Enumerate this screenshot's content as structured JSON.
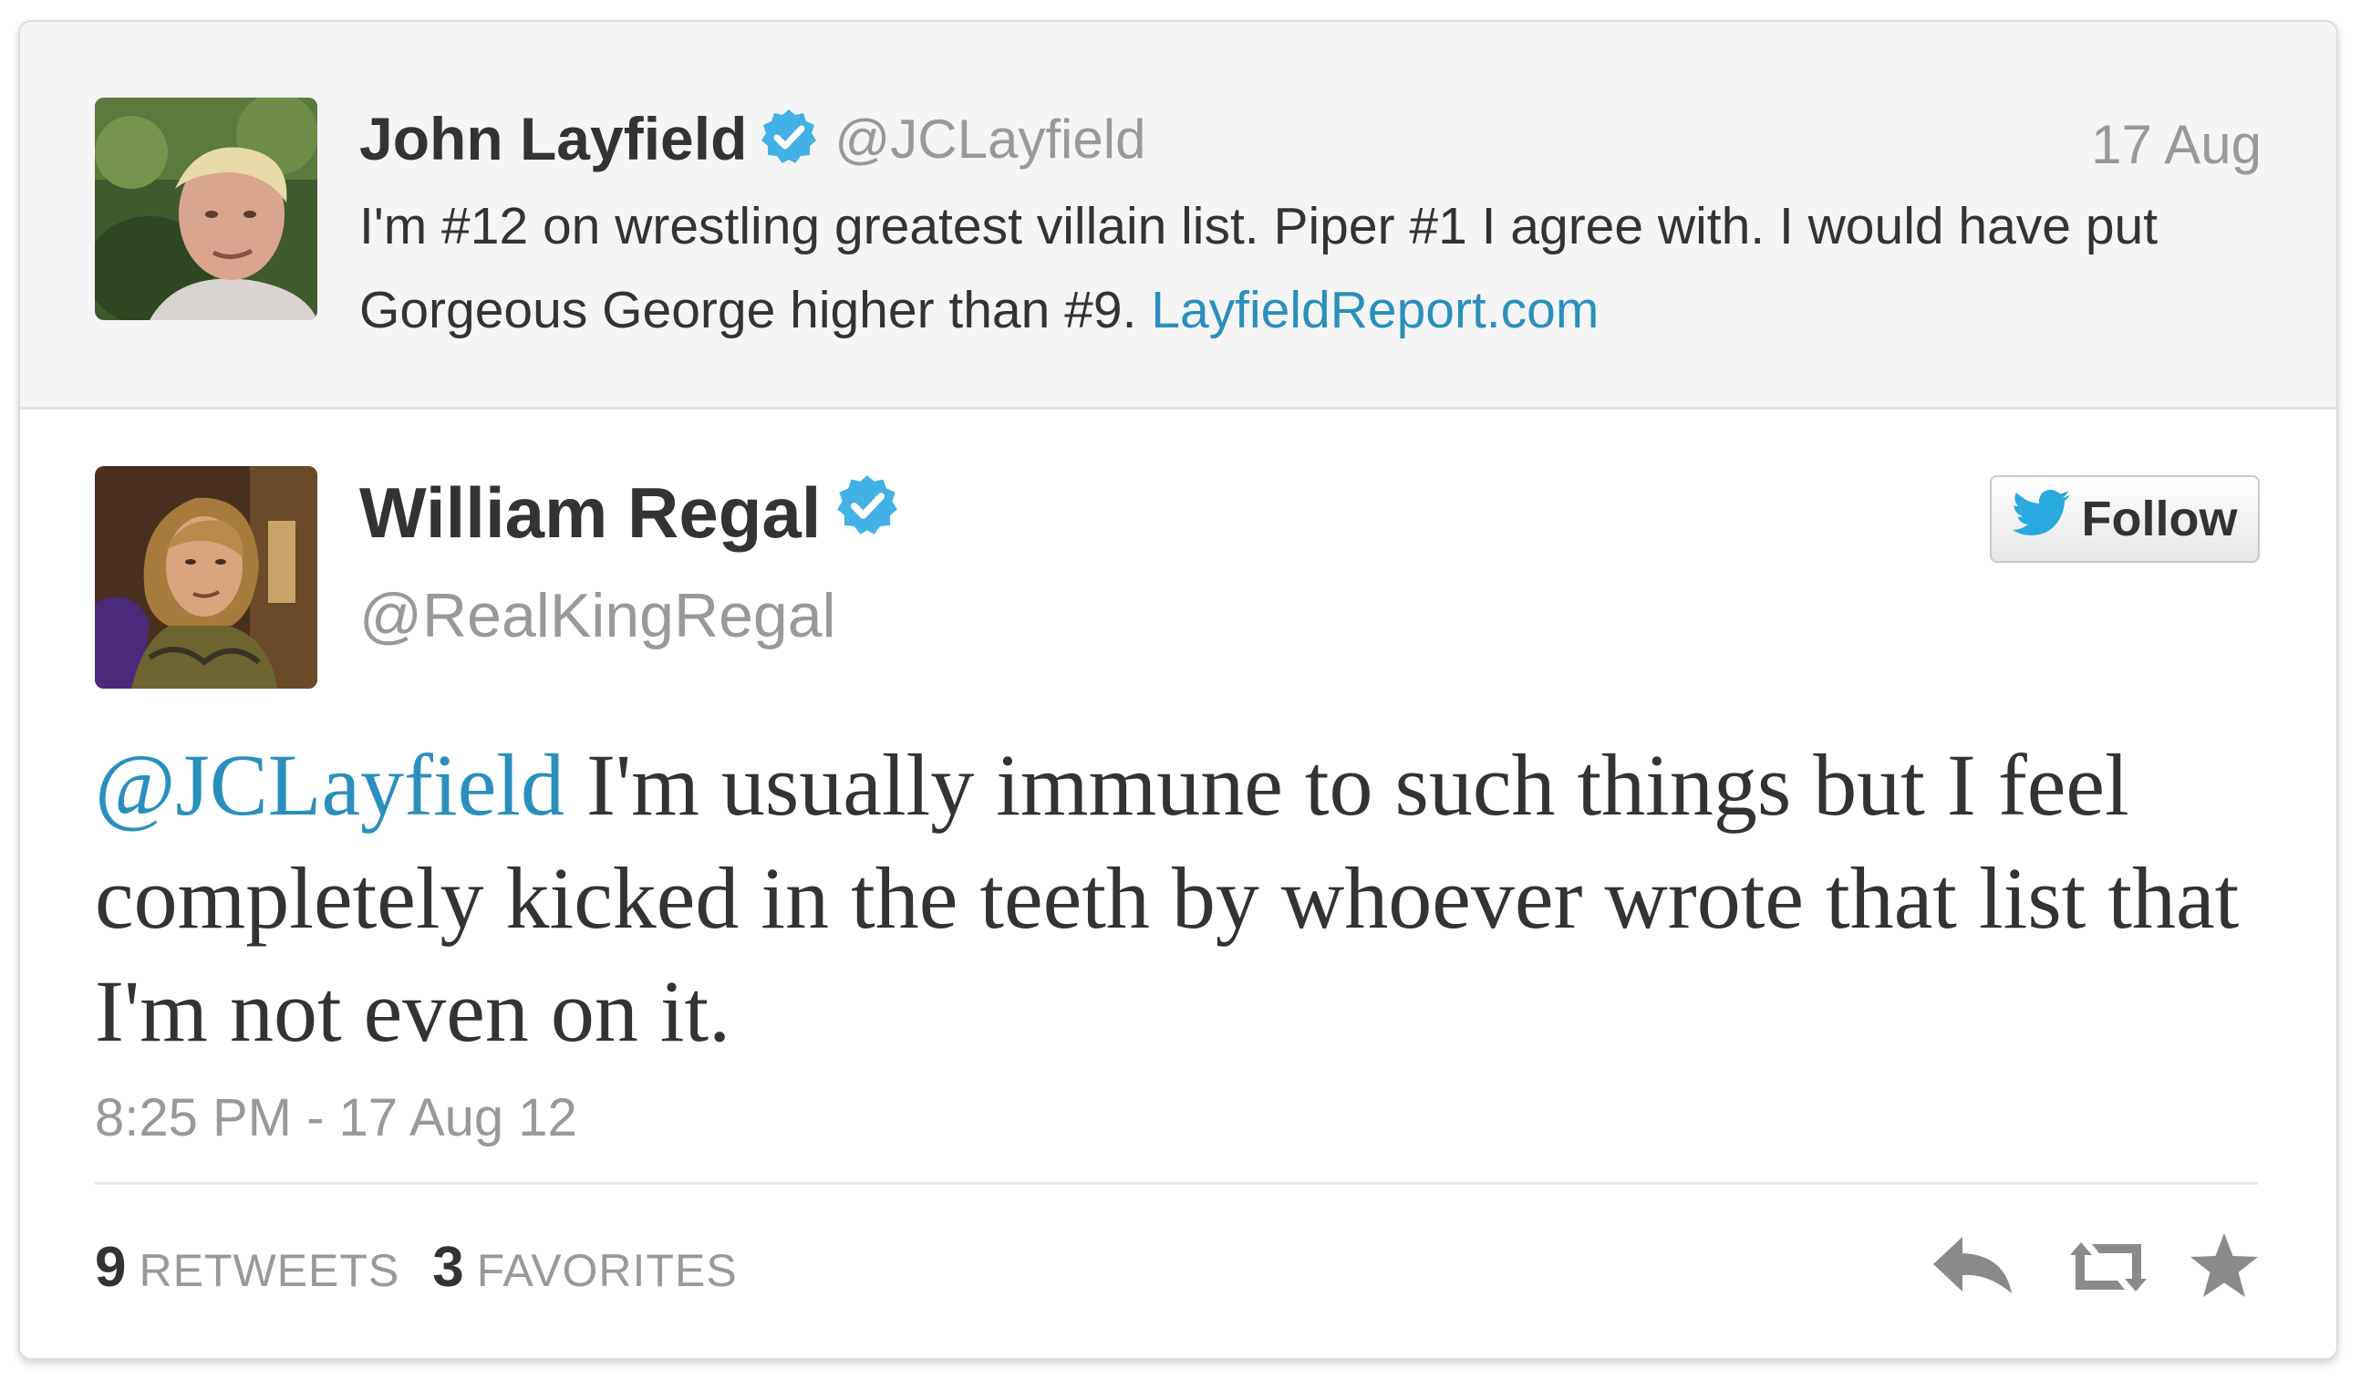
{
  "parent_tweet": {
    "author_name": "John Layfield",
    "author_handle": "@JCLayfield",
    "date": "17 Aug",
    "text_before_link": "I'm #12 on wrestling greatest villain list. Piper #1 I agree with. I would have put Gorgeous George higher than #9. ",
    "link_text": "LayfieldReport.com",
    "verified": true
  },
  "main_tweet": {
    "author_name": "William Regal",
    "author_handle": "@RealKingRegal",
    "verified": true,
    "follow_label": "Follow",
    "mention": "@JCLayfield",
    "text": " I'm usually immune to such things but I feel completely kicked in the teeth by whoever wrote that list that I'm not even on it.",
    "timestamp": "8:25 PM - 17 Aug 12",
    "retweets_count": "9",
    "retweets_label": "RETWEETS",
    "favorites_count": "3",
    "favorites_label": "FAVORITES"
  },
  "icons": {
    "verified": "verified-badge-icon",
    "follow": "twitter-bird-icon",
    "reply": "reply-icon",
    "retweet": "retweet-icon",
    "favorite": "star-icon"
  },
  "colors": {
    "link": "#2a8fbd",
    "verified": "#41b1e6",
    "twitter_bird": "#2aa9e0",
    "action_icons": "#8a8a8a"
  }
}
